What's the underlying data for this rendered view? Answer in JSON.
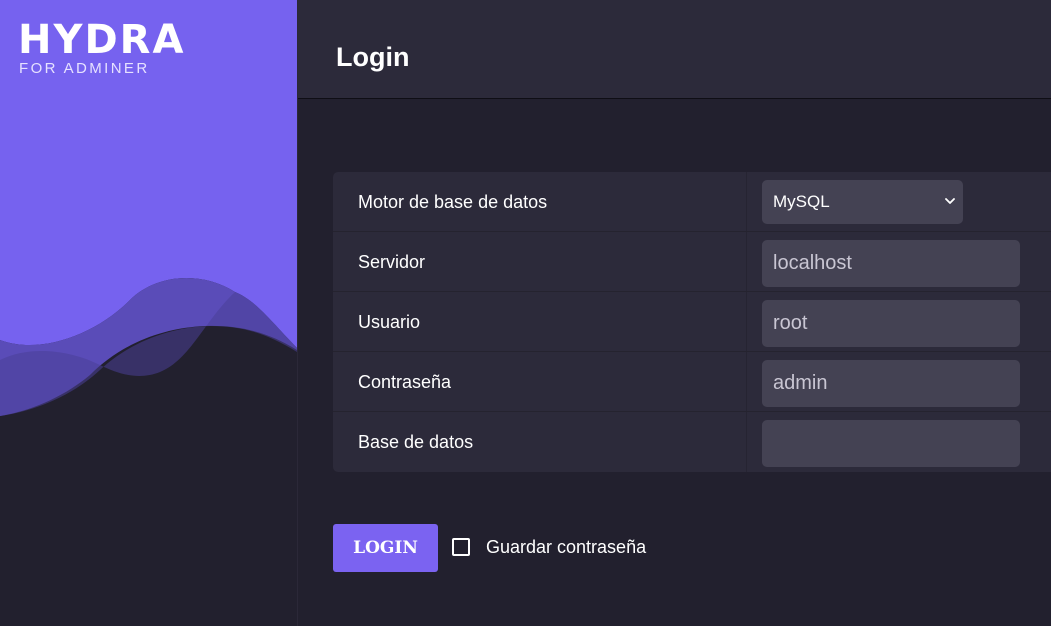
{
  "brand": {
    "logo_main": "HYDRA",
    "logo_sub": "FOR ADMINER",
    "accent_color": "#7b63f1"
  },
  "header": {
    "title": "Login"
  },
  "form": {
    "rows": [
      {
        "label": "Motor de base de datos",
        "type": "select",
        "value": "MySQL"
      },
      {
        "label": "Servidor",
        "type": "text",
        "value": "localhost"
      },
      {
        "label": "Usuario",
        "type": "text",
        "value": "root"
      },
      {
        "label": "Contraseña",
        "type": "text",
        "value": "admin"
      },
      {
        "label": "Base de datos",
        "type": "text",
        "value": ""
      }
    ]
  },
  "actions": {
    "login_label": "LOGIN",
    "remember_label": "Guardar contraseña",
    "remember_checked": false
  }
}
